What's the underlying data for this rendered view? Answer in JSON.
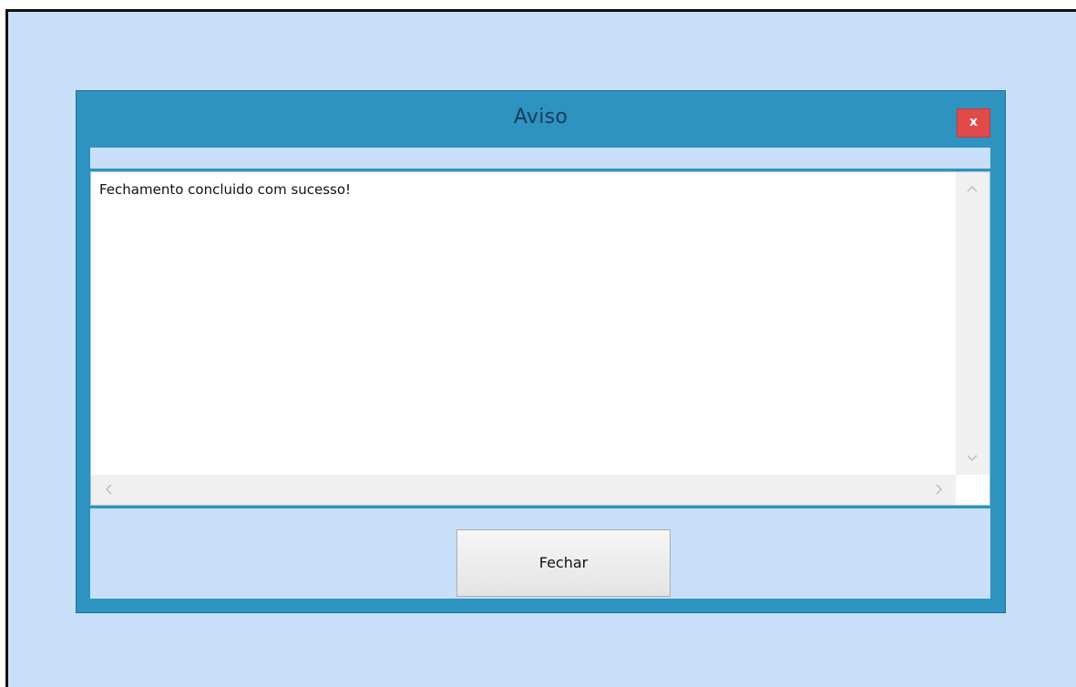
{
  "dialog": {
    "title": "Aviso",
    "close_label": "x",
    "message": "Fechamento concluido com sucesso!",
    "button_label": "Fechar"
  },
  "colors": {
    "background": "#c9def8",
    "frame": "#2e93c1",
    "close_button": "#e04a4a"
  },
  "icons": {
    "scroll_up": "chevron-up-icon",
    "scroll_down": "chevron-down-icon",
    "scroll_left": "chevron-left-icon",
    "scroll_right": "chevron-right-icon"
  }
}
